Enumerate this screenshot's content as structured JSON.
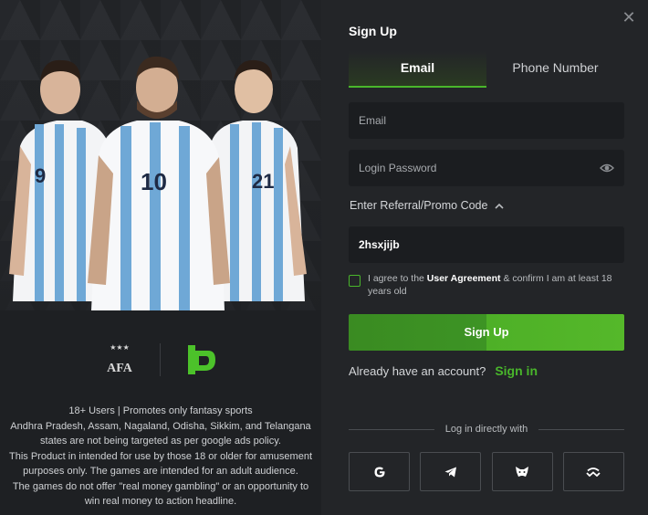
{
  "promo": {
    "disclaimer_lines": [
      "18+ Users | Promotes only fantasy sports",
      "Andhra Pradesh, Assam, Nagaland, Odisha, Sikkim, and Telangana",
      "states are not being targeted as per google ads policy.",
      "This Product in intended for use by those 18 or older for amusement",
      "purposes only. The games are intended for an adult audience.",
      "The games do not offer \"real money gambling\" or an opportunity to",
      "win real money to action headline."
    ],
    "player_numbers": [
      "9",
      "10",
      "21"
    ],
    "afa_logo_text": "AFA"
  },
  "form": {
    "title": "Sign Up",
    "tabs": [
      {
        "label": "Email",
        "active": true
      },
      {
        "label": "Phone Number",
        "active": false
      }
    ],
    "email_placeholder": "Email",
    "password_placeholder": "Login Password",
    "promo_toggle_label": "Enter Referral/Promo Code",
    "promo_code_value": "2hsxjijb",
    "agreement": {
      "prefix": "I agree to the ",
      "link": "User Agreement",
      "suffix": " & confirm I am at least 18 years old"
    },
    "signup_label": "Sign Up",
    "have_account_text": "Already have an account?",
    "signin_label": "Sign in",
    "social_divider_text": "Log in directly with",
    "socials": [
      "google-icon",
      "telegram-icon",
      "metamask-icon",
      "walletconnect-icon"
    ]
  },
  "colors": {
    "accent": "#49b62b",
    "panel": "#232528",
    "field": "#1b1d20"
  }
}
